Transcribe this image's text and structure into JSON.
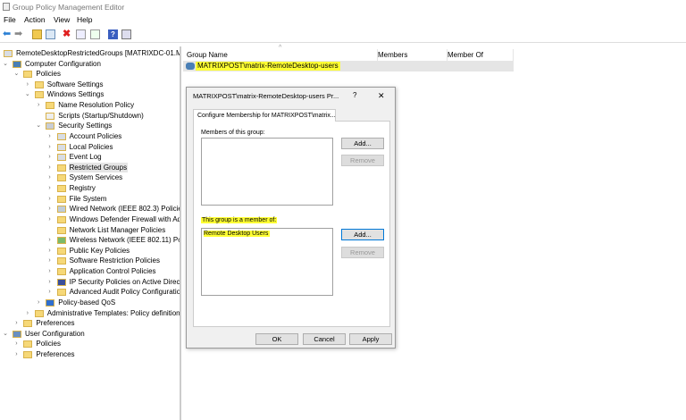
{
  "window": {
    "title": "Group Policy Management Editor"
  },
  "menu": [
    "File",
    "Action",
    "View",
    "Help"
  ],
  "toolbar": [
    "back-icon",
    "forward-icon",
    "up-folder-icon",
    "show-hide-tree-icon",
    "delete-icon",
    "properties-icon",
    "export-icon",
    "help-icon",
    "console-icon"
  ],
  "tree": [
    {
      "label": "RemoteDesktopRestrictedGroups [MATRIXDC-01.MATI",
      "level": 0,
      "exp": "",
      "icon": "policy"
    },
    {
      "label": "Computer Configuration",
      "level": 0,
      "exp": "v",
      "icon": "computer"
    },
    {
      "label": "Policies",
      "level": 1,
      "exp": "v",
      "icon": "folder"
    },
    {
      "label": "Software Settings",
      "level": 2,
      "exp": ">",
      "icon": "folder"
    },
    {
      "label": "Windows Settings",
      "level": 2,
      "exp": "v",
      "icon": "folder"
    },
    {
      "label": "Name Resolution Policy",
      "level": 3,
      "exp": ">",
      "icon": "folder"
    },
    {
      "label": "Scripts (Startup/Shutdown)",
      "level": 3,
      "exp": "",
      "icon": "script"
    },
    {
      "label": "Security Settings",
      "level": 3,
      "exp": "v",
      "icon": "security"
    },
    {
      "label": "Account Policies",
      "level": 4,
      "exp": ">",
      "icon": "policy"
    },
    {
      "label": "Local Policies",
      "level": 4,
      "exp": ">",
      "icon": "policy"
    },
    {
      "label": "Event Log",
      "level": 4,
      "exp": ">",
      "icon": "policy"
    },
    {
      "label": "Restricted Groups",
      "level": 4,
      "exp": ">",
      "icon": "folder-lock",
      "selected": true
    },
    {
      "label": "System Services",
      "level": 4,
      "exp": ">",
      "icon": "folder-lock"
    },
    {
      "label": "Registry",
      "level": 4,
      "exp": ">",
      "icon": "folder-lock"
    },
    {
      "label": "File System",
      "level": 4,
      "exp": ">",
      "icon": "folder-lock"
    },
    {
      "label": "Wired Network (IEEE 802.3) Policies",
      "level": 4,
      "exp": ">",
      "icon": "network"
    },
    {
      "label": "Windows Defender Firewall with Adv",
      "level": 4,
      "exp": ">",
      "icon": "folder"
    },
    {
      "label": "Network List Manager Policies",
      "level": 4,
      "exp": "",
      "icon": "folder"
    },
    {
      "label": "Wireless Network (IEEE 802.11) Polic",
      "level": 4,
      "exp": ">",
      "icon": "wireless"
    },
    {
      "label": "Public Key Policies",
      "level": 4,
      "exp": ">",
      "icon": "folder"
    },
    {
      "label": "Software Restriction Policies",
      "level": 4,
      "exp": ">",
      "icon": "folder"
    },
    {
      "label": "Application Control Policies",
      "level": 4,
      "exp": ">",
      "icon": "folder"
    },
    {
      "label": "IP Security Policies on Active Directo",
      "level": 4,
      "exp": ">",
      "icon": "ipsec"
    },
    {
      "label": "Advanced Audit Policy Configuratio",
      "level": 4,
      "exp": ">",
      "icon": "folder"
    },
    {
      "label": "Policy-based QoS",
      "level": 3,
      "exp": ">",
      "icon": "chart"
    },
    {
      "label": "Administrative Templates: Policy definitions",
      "level": 2,
      "exp": ">",
      "icon": "folder"
    },
    {
      "label": "Preferences",
      "level": 1,
      "exp": ">",
      "icon": "folder"
    },
    {
      "label": "User Configuration",
      "level": 0,
      "exp": "v",
      "icon": "user"
    },
    {
      "label": "Policies",
      "level": 1,
      "exp": ">",
      "icon": "folder"
    },
    {
      "label": "Preferences",
      "level": 1,
      "exp": ">",
      "icon": "folder"
    }
  ],
  "list": {
    "columns": [
      "Group Name",
      "Members",
      "Member Of"
    ],
    "rows": [
      {
        "name": "MATRIXPOST\\matrix-RemoteDesktop-users",
        "members": "",
        "member_of": ""
      }
    ]
  },
  "dialog": {
    "title": "MATRIXPOST\\matrix-RemoteDesktop-users Pr...",
    "help": "?",
    "close": "✕",
    "tab": "Configure Membership for MATRIXPOST\\matrix...",
    "members_label": "Members of this group:",
    "members": [],
    "memberof_label": "This group is a member of:",
    "memberof": [
      "Remote Desktop Users"
    ],
    "add": "Add...",
    "remove": "Remove",
    "ok": "OK",
    "cancel": "Cancel",
    "apply": "Apply"
  },
  "colors": {
    "highlight": "#ffff33",
    "selection": "#e5e5e5"
  }
}
